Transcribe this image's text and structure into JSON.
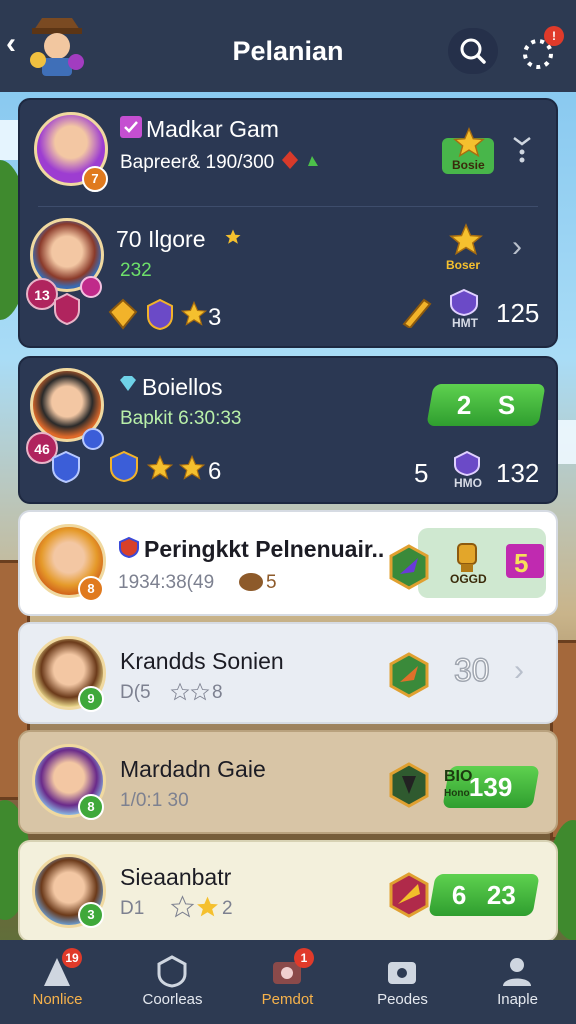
{
  "header": {
    "title": "Pelanian",
    "menu_badge": "!"
  },
  "cards": [
    {
      "name": "Madkar Gam",
      "sub": "Bapreer& 190/300",
      "rank": "7",
      "badge": "Bosie"
    },
    {
      "name": "70 Ilgore",
      "sub": "232",
      "rank": "13",
      "badge": "Boser",
      "stars": "3",
      "side_label": "HMT",
      "score": "125"
    },
    {
      "name": "Boiellos",
      "sub": "Bapkit 6:30:33",
      "rank": "46",
      "pill_a": "2",
      "pill_b": "S",
      "stars": "6",
      "left_num": "5",
      "side_label": "HMO",
      "score": "132"
    },
    {
      "name": "Peringkkt Pelnenuair..",
      "sub": "1934:38(49",
      "extra": "5",
      "rank": "8",
      "badge": "OGGD",
      "score": "5"
    },
    {
      "name": "Krandds Sonien",
      "sub": "D(5",
      "extra": "8",
      "rank": "9",
      "score": "30"
    },
    {
      "name": "Mardadn Gaie",
      "sub": "1/0:1 30",
      "rank": "8",
      "tag": "BIO",
      "tag_sub": "Hono",
      "score": "139"
    },
    {
      "name": "Sieaanbatr",
      "sub": "D1",
      "extra": "2",
      "rank": "3",
      "pill_a": "6",
      "score": "23"
    }
  ],
  "tabs": [
    {
      "label": "Nonlice",
      "badge": "19"
    },
    {
      "label": "Coorleas"
    },
    {
      "label": "Pemdot",
      "badge": "1"
    },
    {
      "label": "Peodes"
    },
    {
      "label": "Inaple"
    }
  ],
  "colors": {
    "header": "#2d3a52",
    "accent_gold": "#f6b24b",
    "green": "#3fb83a"
  }
}
